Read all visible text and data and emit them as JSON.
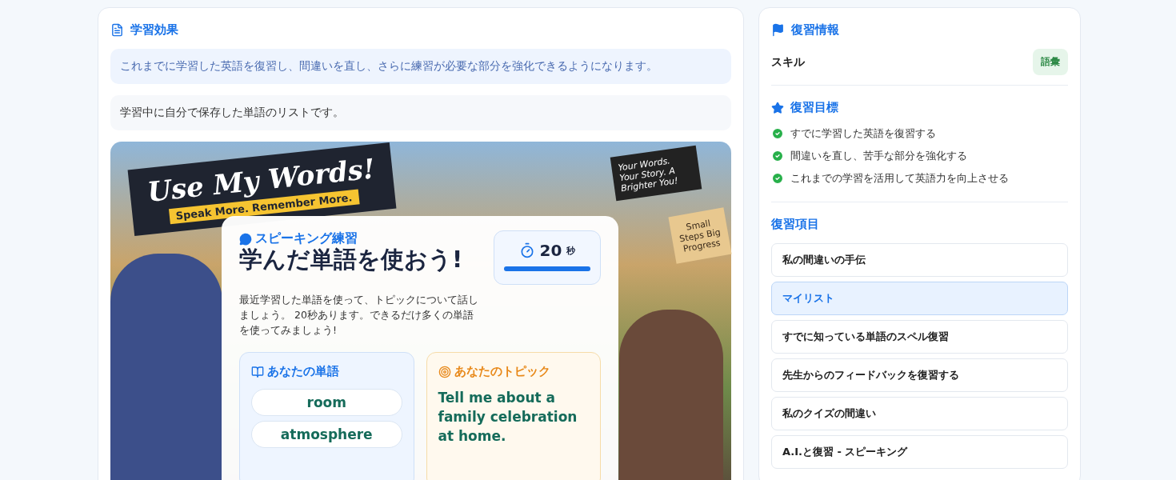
{
  "learning_effect": {
    "title": "学習効果",
    "summary": "これまでに学習した英語を復習し、間違いを直し、さらに練習が必要な部分を強化できるようになります。",
    "description": "学習中に自分で保存した単語のリストです。",
    "illustration": {
      "banner_title": "Use My Words!",
      "banner_subtitle": "Speak More. Remember More.",
      "sign_text": "Your Words. Your Story. A Brighter You!",
      "tag_text": "Small Steps Big Progress",
      "card": {
        "eyebrow": "スピーキング練習",
        "heading": "学んだ単語を使おう!",
        "instructions": "最近学習した単語を使って、トピックについて話しましょう。 20秒あります。できるだけ多くの単語を使ってみましょう!",
        "timer": {
          "value": "20",
          "unit": "秒",
          "level": 1
        },
        "words_title": "あなたの単語",
        "words": [
          "room",
          "atmosphere"
        ],
        "topic_title": "あなたのトピック",
        "topic": "Tell me about a family celebration at home."
      }
    }
  },
  "review_info": {
    "title": "復習情報",
    "skill_label": "スキル",
    "skill_value": "語彙",
    "goals_title": "復習目標",
    "goals": [
      {
        "text": "すでに学習した英語を復習する",
        "checked": true
      },
      {
        "text": "間違いを直し、苦手な部分を強化する",
        "checked": true
      },
      {
        "text": "これまでの学習を活用して英語力を向上させる",
        "checked": true
      }
    ],
    "items_title": "復習項目",
    "items": [
      {
        "label": "私の間違いの手伝",
        "selected": false
      },
      {
        "label": "マイリスト",
        "selected": true
      },
      {
        "label": "すでに知っている単語のスペル復習",
        "selected": false
      },
      {
        "label": "先生からのフィードバックを復習する",
        "selected": false
      },
      {
        "label": "私のクイズの間違い",
        "selected": false
      },
      {
        "label": "A.I.と復習 - スピーキング",
        "selected": false
      }
    ]
  }
}
